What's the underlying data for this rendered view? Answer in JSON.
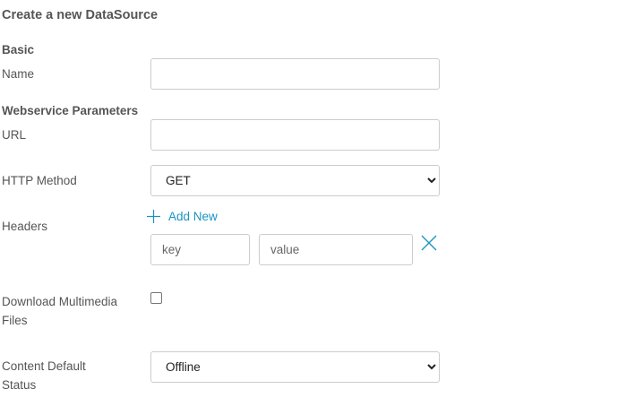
{
  "page": {
    "title": "Create a new DataSource"
  },
  "basic": {
    "heading": "Basic",
    "name_label": "Name",
    "name_value": ""
  },
  "webservice": {
    "heading": "Webservice Parameters",
    "url_label": "URL",
    "url_value": "",
    "http_method_label": "HTTP Method",
    "http_method_value": "GET",
    "headers_label": "Headers",
    "add_new_label": "Add New",
    "header_key_placeholder": "key",
    "header_value_placeholder": "value"
  },
  "multimedia": {
    "label_line1": "Download Multimedia",
    "label_line2": "Files",
    "checked": false
  },
  "content_status": {
    "label_line1": "Content Default",
    "label_line2": "Status",
    "value": "Offline"
  },
  "colors": {
    "accent": "#1a93c2",
    "border": "#cccccc",
    "text": "#555555"
  },
  "icons": {
    "add": "plus-icon",
    "remove": "close-icon"
  }
}
